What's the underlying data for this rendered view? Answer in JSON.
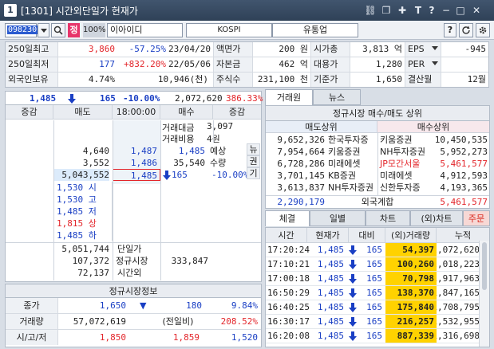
{
  "window": {
    "number": "1",
    "title": "[1301] 시간외단일가 현재가"
  },
  "toolbar": {
    "code": "098230",
    "jeong_label": "정",
    "ratio_label": "100%",
    "stock_name": "이아이디",
    "market": "KOSPI",
    "sector": "유통업",
    "help": "?"
  },
  "info": {
    "r1": {
      "l1": "250일최고",
      "v1": "3,860",
      "v2": "-57.25%",
      "v3": "23/04/20",
      "l2": "액면가",
      "v4": "200 원",
      "l3": "시가총",
      "v5": "3,813 억",
      "l4": "EPS",
      "v6": "-945"
    },
    "r2": {
      "l1": "250일최저",
      "v1": "177",
      "v2": "+832.20%",
      "v3": "22/05/06",
      "l2": "자본금",
      "v4": "462 억",
      "l3": "대용가",
      "v5": "1,280",
      "l4": "PER",
      "v6": ""
    },
    "r3": {
      "l1": "외국인보유",
      "v1": "4.74%",
      "v3": "10,946(천)",
      "l2": "주식수",
      "v4": "231,100 천",
      "l3": "기준가",
      "v5": "1,650",
      "l4": "결산월",
      "v6": "12월"
    }
  },
  "orderbook": {
    "summary": {
      "price": "1,485",
      "change": "165",
      "rate": "-10.00%",
      "volume": "2,072,620",
      "ratio": "386.33%"
    },
    "headers": {
      "h1": "증감",
      "h2": "매도",
      "h3": "18:00:00",
      "h4": "매수",
      "h5": "증감"
    },
    "ask_rows": [
      {
        "qty": "4,640",
        "price": "1,487"
      },
      {
        "qty": "3,552",
        "price": "1,486"
      },
      {
        "qty": "5,043,552",
        "price": "1,485"
      }
    ],
    "bid_rows": [
      {
        "price": "1,485",
        "qty": ""
      },
      {
        "price": "1,486",
        "qty": ""
      },
      {
        "price": "1,487",
        "qty": ""
      }
    ],
    "trade_amt_label": "거래대금",
    "trade_amt": "3,097",
    "trade_cost_label": "거래비용",
    "trade_cost": "4원",
    "expect_label": "예상",
    "expect_price": "1,485",
    "expect_qty_label": "수량",
    "expect_qty": "35,540",
    "expect_chg": "165",
    "expect_rate": "-10.00%",
    "side_labels": [
      "뉴",
      "권",
      "기"
    ],
    "limits": [
      {
        "price": "1,530",
        "label": "시",
        "color": "blue"
      },
      {
        "price": "1,530",
        "label": "고",
        "color": "blue"
      },
      {
        "price": "1,485",
        "label": "저",
        "color": "blue"
      },
      {
        "price": "1,815",
        "label": "상",
        "color": "red"
      },
      {
        "price": "1,485",
        "label": "하",
        "color": "blue"
      }
    ],
    "totals": {
      "ask_total": "5,051,744",
      "bid_total": "333,847",
      "l1": "단일가",
      "l2": "정규시장",
      "l3": "시간외",
      "v2": "107,372",
      "v3": "72,137"
    }
  },
  "regular": {
    "title": "정규시장정보",
    "r1": {
      "l": "종가",
      "v": "1,650",
      "chg": "180",
      "rate": "9.84%"
    },
    "r2": {
      "l": "거래량",
      "v": "57,072,619",
      "mid": "(전일비)",
      "rate": "208.52%"
    },
    "r3": {
      "l": "시/고/저",
      "open": "1,850",
      "high": "1,859",
      "low": "1,520"
    }
  },
  "right_tabs": {
    "t1": "거래원",
    "t2": "뉴스"
  },
  "broker": {
    "title": "정규시장 매수/매도 상위",
    "sell_head": "매도상위",
    "buy_head": "매수상위",
    "rows": [
      {
        "sq": "9,652,326",
        "sn": "한국투자증",
        "bn": "키움증권",
        "bq": "10,450,535",
        "bc": "dark"
      },
      {
        "sq": "7,954,664",
        "sn": "키움증권",
        "bn": "NH투자증권",
        "bq": "5,952,273",
        "bc": "dark"
      },
      {
        "sq": "6,728,286",
        "sn": "미래에셋",
        "bn": "JP모간서울",
        "bq": "5,461,577",
        "bc": "red"
      },
      {
        "sq": "3,701,145",
        "sn": "KB증권",
        "bn": "미래에셋",
        "bq": "4,912,593",
        "bc": "dark"
      },
      {
        "sq": "3,613,837",
        "sn": "NH투자증권",
        "bn": "신한투자증",
        "bq": "4,193,365",
        "bc": "dark"
      }
    ],
    "foreign_sell": "2,290,179",
    "foreign_label": "외국계합",
    "foreign_buy": "5,461,577"
  },
  "trade_tabs": {
    "t1": "체결",
    "t2": "일별",
    "t3": "차트",
    "t4": "(외)차트",
    "t5": "주문"
  },
  "trades": {
    "headers": {
      "h1": "시간",
      "h2": "현재가",
      "h3": "대비",
      "h4": "(외)거래량",
      "h5": "누적"
    },
    "rows": [
      {
        "time": "17:20:24",
        "price": "1,485",
        "chg": "165",
        "vol": "54,397",
        "cum": "2,072,620"
      },
      {
        "time": "17:10:21",
        "price": "1,485",
        "chg": "165",
        "vol": "100,260",
        "cum": "2,018,223"
      },
      {
        "time": "17:00:18",
        "price": "1,485",
        "chg": "165",
        "vol": "70,798",
        "cum": "1,917,963"
      },
      {
        "time": "16:50:29",
        "price": "1,485",
        "chg": "165",
        "vol": "138,370",
        "cum": "1,847,165"
      },
      {
        "time": "16:40:25",
        "price": "1,485",
        "chg": "165",
        "vol": "175,840",
        "cum": "1,708,795"
      },
      {
        "time": "16:30:17",
        "price": "1,485",
        "chg": "165",
        "vol": "216,257",
        "cum": "1,532,955"
      },
      {
        "time": "16:20:08",
        "price": "1,485",
        "chg": "165",
        "vol": "887,339",
        "cum": "1,316,698"
      }
    ]
  },
  "colors": {
    "up": "#e3262b",
    "down": "#1a3fc4",
    "highlight": "#ffd200",
    "accent": "#e7356a"
  }
}
